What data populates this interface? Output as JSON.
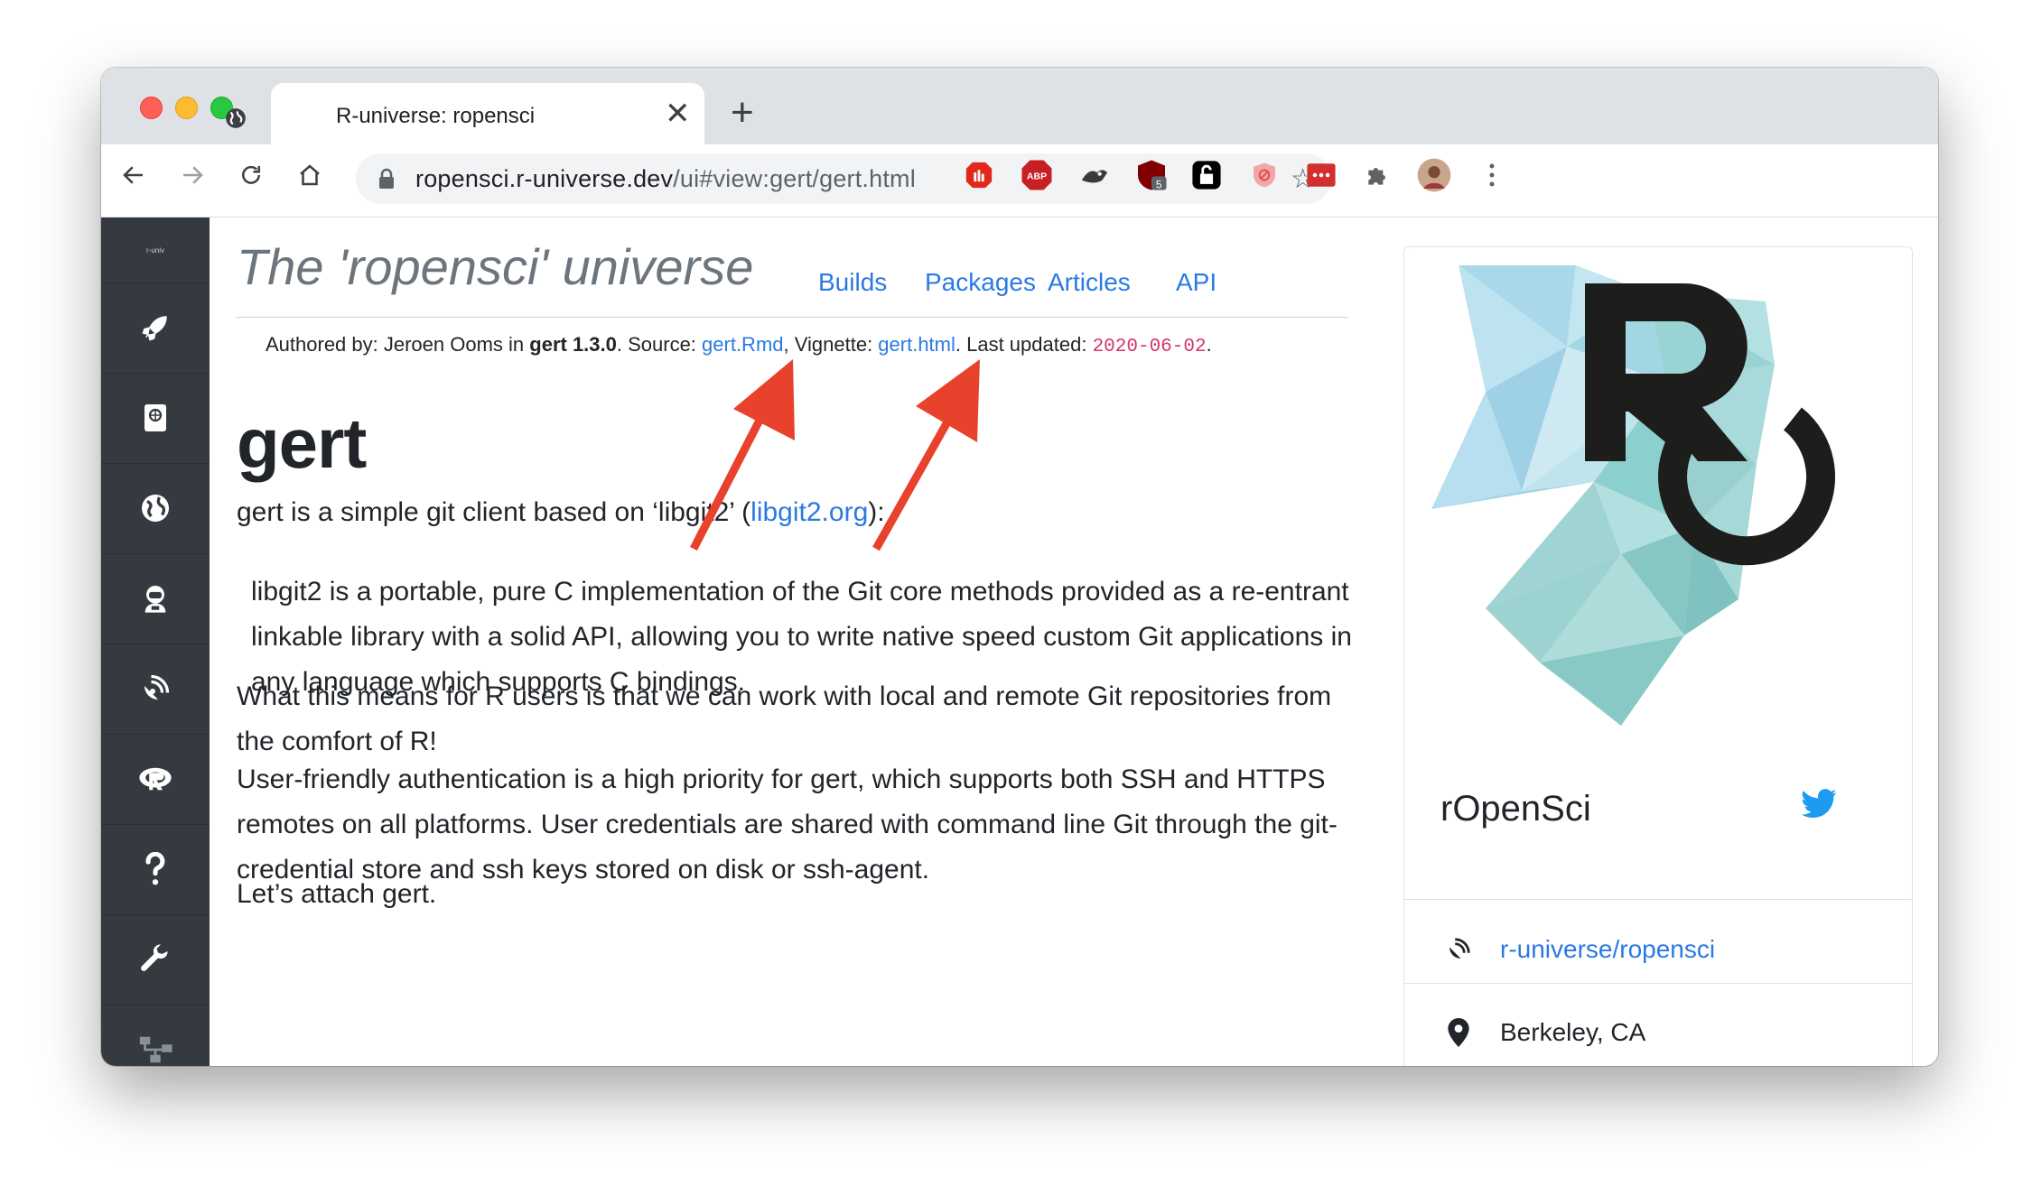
{
  "browser": {
    "tab_title": "R-universe: ropensci",
    "tab_close": "✕",
    "new_tab": "+",
    "url_host": "ropensci.r-universe.dev",
    "url_rest": "/ui#view:gert/gert.html",
    "extensions": [
      "stop-ad-extension",
      "abp-extension",
      "dog-extension",
      "ublock-extension",
      "lock-extension",
      "shield-extension",
      "dots-extension",
      "puzzle-extension",
      "profile-avatar"
    ],
    "ublock_badge": "5"
  },
  "sidebar": {
    "logo_text": "r-univ",
    "items": [
      "rocket-icon",
      "book-icon",
      "globe-icon",
      "user-astronaut-icon",
      "satellite-icon",
      "r-logo-icon",
      "question-icon",
      "wrench-icon",
      "sitemap-icon"
    ]
  },
  "header": {
    "site_title": "The 'ropensci' universe",
    "nav": [
      "Builds",
      "Packages",
      "Articles",
      "API"
    ]
  },
  "meta": {
    "authored_by_prefix": "Authored by: Jeroen Ooms in ",
    "package_version": "gert 1.3.0",
    "source_prefix": ". Source: ",
    "source_link": "gert.Rmd",
    "vignette_prefix": ", Vignette: ",
    "vignette_link": "gert.html",
    "updated_prefix": ". Last updated: ",
    "updated_date": "2020-06-02",
    "suffix": "."
  },
  "article": {
    "title": "gert",
    "intro_prefix": "gert is a simple git client based on ‘libgit2’ (",
    "intro_link": "libgit2.org",
    "intro_suffix": "):",
    "quote": "libgit2 is a portable, pure C implementation of the Git core methods provided as a re-entrant linkable library with a solid API, allowing you to write native speed custom Git applications in any language which supports C bindings.",
    "para1": "What this means for R users is that we can work with local and remote Git repositories from the comfort of R!",
    "para2": "User-friendly authentication is a high priority for gert, which supports both SSH and HTTPS remotes on all platforms. User credentials are shared with command line Git through the git-credential store and ssh keys stored on disk or ssh-agent.",
    "para3": "Let’s attach gert."
  },
  "profile_card": {
    "name": "rOpenSci",
    "universe_link": "r-universe/ropensci",
    "location": "Berkeley, CA"
  },
  "colors": {
    "link": "#2a7ae2",
    "sidebar": "#343a40",
    "annotation_arrow": "#e8412c",
    "twitter": "#1d9bf0"
  }
}
